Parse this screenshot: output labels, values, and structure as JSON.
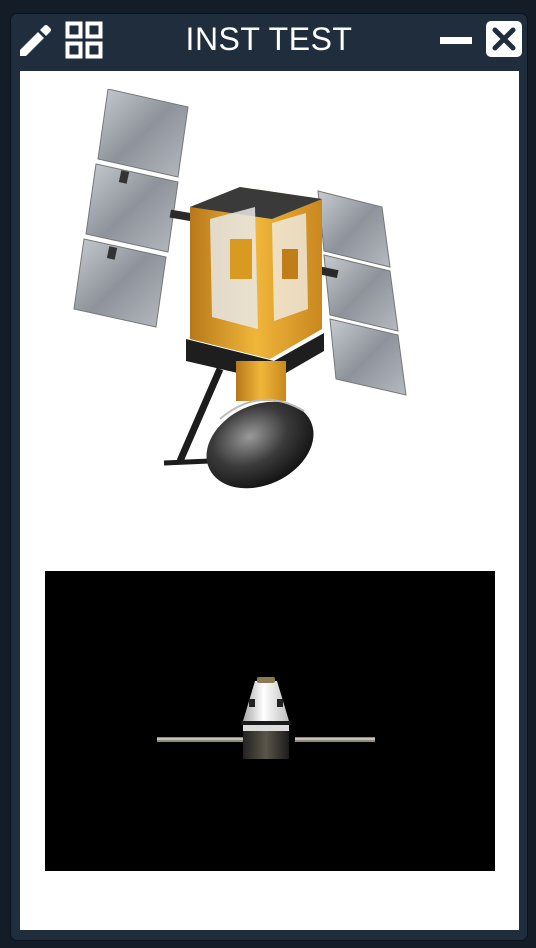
{
  "window": {
    "title": "INST TEST",
    "icons": {
      "edit": "pencil-icon",
      "layout": "grid-icon",
      "minimize": "minimize-icon",
      "close": "close-icon"
    }
  },
  "content": {
    "images": [
      {
        "name": "satellite-image",
        "kind": "satellite with solar panels and dish antenna"
      },
      {
        "name": "capsule-video",
        "kind": "capsule spacecraft on black background"
      }
    ]
  },
  "colors": {
    "titlebar": "#1f2d3d",
    "background": "#141c27",
    "panel": "#ffffff",
    "gold_foil": "#e9a526",
    "solar_panel": "#a9aeb6"
  }
}
